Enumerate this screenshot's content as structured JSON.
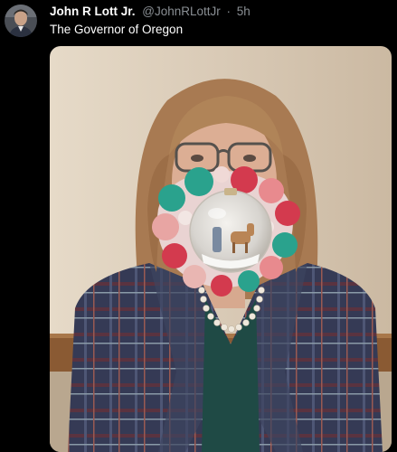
{
  "tweet": {
    "display_name": "John R Lott Jr.",
    "handle": "@JohnRLottJr",
    "separator": "·",
    "time": "5h",
    "text": "The Governor of Oregon"
  },
  "icons": {
    "avatar": "profile-avatar",
    "media": "tweet-photo"
  },
  "colors": {
    "background": "#000000",
    "primary_text": "#ffffff",
    "secondary_text": "#8a8f94",
    "photo_wall": "#d8c9b5",
    "blazer": "#3a3f5a",
    "hair": "#a87a52"
  }
}
